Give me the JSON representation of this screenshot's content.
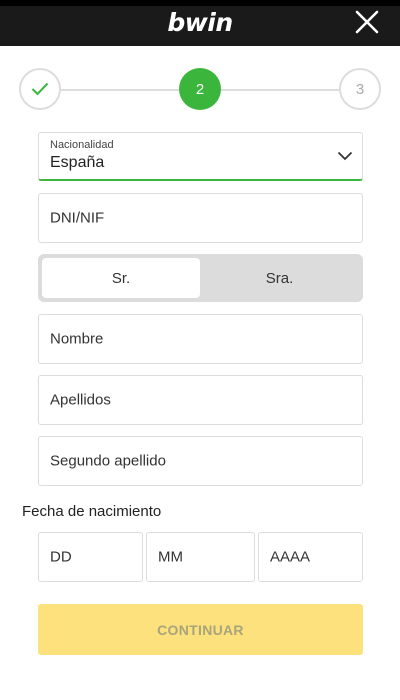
{
  "header": {
    "logo": "bwin",
    "close_icon": "close-icon"
  },
  "stepper": {
    "steps": [
      {
        "state": "completed",
        "icon": "check-icon"
      },
      {
        "label": "2",
        "state": "active"
      },
      {
        "label": "3",
        "state": "upcoming"
      }
    ]
  },
  "form": {
    "nationality": {
      "label": "Nacionalidad",
      "value": "España"
    },
    "dni": {
      "placeholder": "DNI/NIF"
    },
    "title": {
      "options": [
        "Sr.",
        "Sra."
      ],
      "selected": "Sr."
    },
    "first_name": {
      "placeholder": "Nombre"
    },
    "last_name": {
      "placeholder": "Apellidos"
    },
    "second_last_name": {
      "placeholder": "Segundo apellido"
    },
    "birth_date": {
      "label": "Fecha de nacimiento",
      "day_placeholder": "DD",
      "month_placeholder": "MM",
      "year_placeholder": "AAAA"
    },
    "submit_label": "CONTINUAR"
  },
  "colors": {
    "header_bg": "#1a1a1a",
    "accent_green": "#3bb53b",
    "button_yellow": "#fce17d",
    "button_text": "#a8a47c"
  }
}
